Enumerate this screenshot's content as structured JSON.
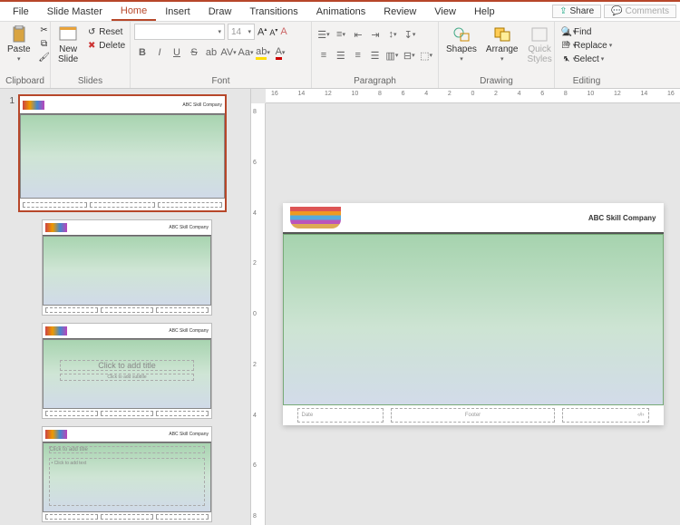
{
  "menu": {
    "tabs": [
      "File",
      "Slide Master",
      "Home",
      "Insert",
      "Draw",
      "Transitions",
      "Animations",
      "Review",
      "View",
      "Help"
    ],
    "active": "Home",
    "share": "Share",
    "comments": "Comments"
  },
  "ribbon": {
    "clipboard": {
      "label": "Clipboard",
      "paste": "Paste"
    },
    "slides": {
      "label": "Slides",
      "new_slide": "New\nSlide",
      "reset": "Reset",
      "delete": "Delete"
    },
    "font": {
      "label": "Font",
      "size": "14"
    },
    "paragraph": {
      "label": "Paragraph"
    },
    "drawing": {
      "label": "Drawing",
      "shapes": "Shapes",
      "arrange": "Arrange",
      "quick": "Quick\nStyles"
    },
    "editing": {
      "label": "Editing",
      "find": "Find",
      "replace": "Replace",
      "select": "Select"
    }
  },
  "thumbs": {
    "num1": "1",
    "company_mini": "ABC Skill Company",
    "layout2_title": "Click to add title",
    "layout2_sub": "Click to add subtitle",
    "layout3_title": "Click to add title",
    "layout3_body": "Click to add text"
  },
  "slide": {
    "company": "ABC Skill Company",
    "date": "Date",
    "footer": "Footer",
    "pagenum": "‹#›"
  },
  "ruler_h": [
    "16",
    "14",
    "12",
    "10",
    "8",
    "6",
    "4",
    "2",
    "0",
    "2",
    "4",
    "6",
    "8",
    "10",
    "12",
    "14",
    "16"
  ],
  "ruler_v": [
    "8",
    "6",
    "4",
    "2",
    "0",
    "2",
    "4",
    "6",
    "8"
  ]
}
